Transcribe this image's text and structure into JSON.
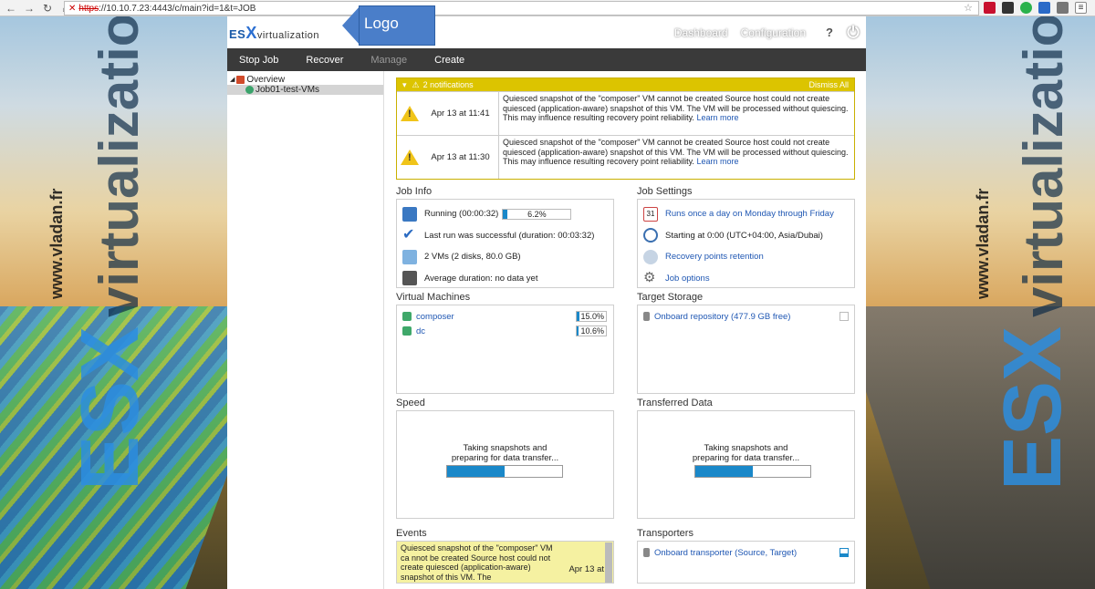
{
  "browser": {
    "url_https": "https",
    "url_rest": "://10.10.7.23:4443/c/main?id=1&t=JOB"
  },
  "watermark": {
    "site": "www.vladan.fr",
    "brand_esx": "ES",
    "brand_x": "X",
    "brand_virt": "virtualization"
  },
  "header": {
    "logo_es": "ES",
    "logo_x": "X",
    "logo_virt": "virtualization",
    "callout": "Logo",
    "nav": [
      "Dashboard",
      "Configuration"
    ],
    "help_icon": "?",
    "power_icon": "⏻"
  },
  "menubar": {
    "items": [
      "Stop Job",
      "Recover",
      "Manage",
      "Create"
    ]
  },
  "tree": {
    "root": "Overview",
    "child": "Job01-test-VMs"
  },
  "notifications": {
    "header": "2 notifications",
    "dismiss": "Dismiss All",
    "items": [
      {
        "date": "Apr 13 at 11:41",
        "message": "Quiesced snapshot of the \"composer\" VM cannot be created Source host could not create quiesced (application-aware) snapshot of this VM. The VM will be processed without quiescing. This may influence resulting recovery point reliability.",
        "link": "Learn more"
      },
      {
        "date": "Apr 13 at 11:30",
        "message": "Quiesced snapshot of the \"composer\" VM cannot be created Source host could not create quiesced (application-aware) snapshot of this VM. The VM will be processed without quiescing. This may influence resulting recovery point reliability.",
        "link": "Learn more"
      }
    ]
  },
  "job_info": {
    "title": "Job Info",
    "running": "Running (00:00:32)",
    "progress_label": "6.2%",
    "progress": 6.2,
    "last_run": "Last run was successful (duration: 00:03:32)",
    "vms": "2 VMs (2 disks, 80.0 GB)",
    "avg": "Average duration: no data yet"
  },
  "job_settings": {
    "title": "Job Settings",
    "schedule": "Runs once a day on Monday through Friday",
    "start": "Starting at 0:00 (UTC+04:00, Asia/Dubai)",
    "retention": "Recovery points retention",
    "options": "Job options",
    "calendar_day": "31"
  },
  "virtual_machines": {
    "title": "Virtual Machines",
    "items": [
      {
        "name": "composer",
        "pct": "15.0%",
        "value": 15.0
      },
      {
        "name": "dc",
        "pct": "10.6%",
        "value": 10.6
      }
    ]
  },
  "target_storage": {
    "title": "Target Storage",
    "repo": "Onboard repository (477.9 GB free)"
  },
  "speed": {
    "title": "Speed",
    "line1": "Taking snapshots and",
    "line2": "preparing for data transfer..."
  },
  "transferred": {
    "title": "Transferred Data",
    "line1": "Taking snapshots and",
    "line2": "preparing for data transfer..."
  },
  "events": {
    "title": "Events",
    "message": "Quiesced snapshot of the \"composer\" VM ca nnot be created Source host could not create quiesced (application-aware) snapshot of this VM. The",
    "date": "Apr 13 at"
  },
  "transporters": {
    "title": "Transporters",
    "item": "Onboard transporter (Source, Target)"
  },
  "colors": {
    "accent": "#1a88c9",
    "notif": "#dcc400",
    "menubar": "#3a3a3a",
    "callout": "#4a7ec9"
  }
}
